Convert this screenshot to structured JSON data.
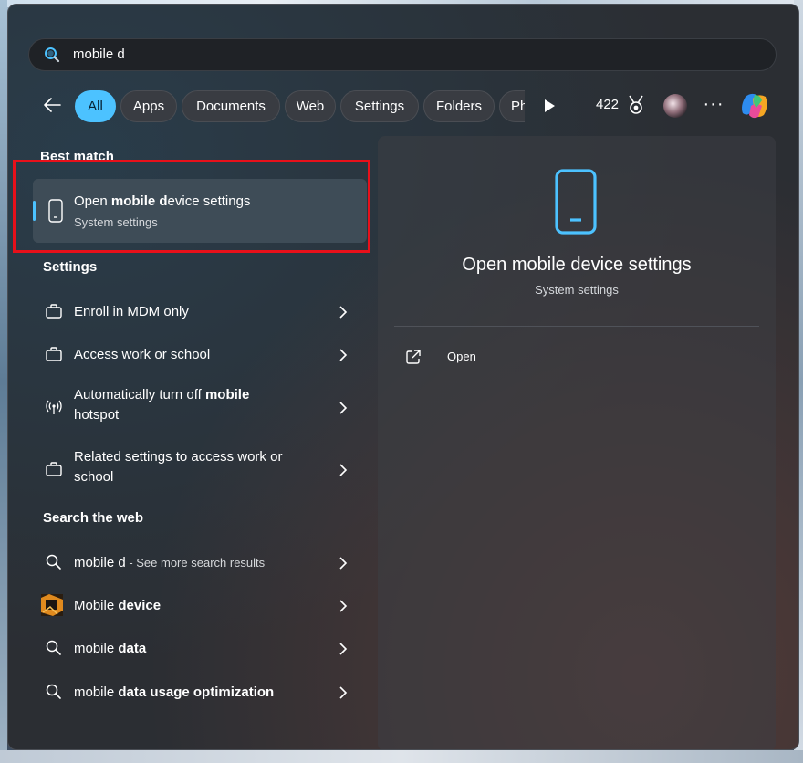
{
  "search": {
    "value": "mobile d"
  },
  "filters": {
    "chips": [
      {
        "label": "All"
      },
      {
        "label": "Apps"
      },
      {
        "label": "Documents"
      },
      {
        "label": "Web"
      },
      {
        "label": "Settings"
      },
      {
        "label": "Folders"
      },
      {
        "label": "Ph"
      }
    ],
    "points": "422"
  },
  "best_match": {
    "heading": "Best match",
    "title_pre": "Open ",
    "title_bold": "mobile d",
    "title_post": "evice settings",
    "subtitle": "System settings"
  },
  "settings_section": {
    "heading": "Settings",
    "items": [
      {
        "text": "Enroll in MDM only",
        "icon": "briefcase-icon"
      },
      {
        "text": "Access work or school",
        "icon": "briefcase-icon"
      },
      {
        "text_pre": "Automatically turn off ",
        "text_bold": "mobile",
        "text_line2": "hotspot",
        "icon": "hotspot-icon"
      },
      {
        "text_line1": "Related settings to access work or",
        "text_line2": "school",
        "icon": "briefcase-icon"
      }
    ]
  },
  "web_section": {
    "heading": "Search the web",
    "items": [
      {
        "text": "mobile d",
        "suffix": " - See more search results",
        "icon": "search-icon"
      },
      {
        "text_pre": "Mobile ",
        "text_bold": "device",
        "icon": "image-thumbnail-icon"
      },
      {
        "text_pre": "mobile ",
        "text_bold": "data",
        "icon": "search-icon"
      },
      {
        "text_pre": "mobile ",
        "text_bold": "data usage optimization",
        "icon": "search-icon"
      }
    ]
  },
  "preview": {
    "title": "Open mobile device settings",
    "subtitle": "System settings",
    "action_label": "Open"
  },
  "colors": {
    "accent": "#4cc2ff",
    "highlight_border": "#e8101a"
  }
}
